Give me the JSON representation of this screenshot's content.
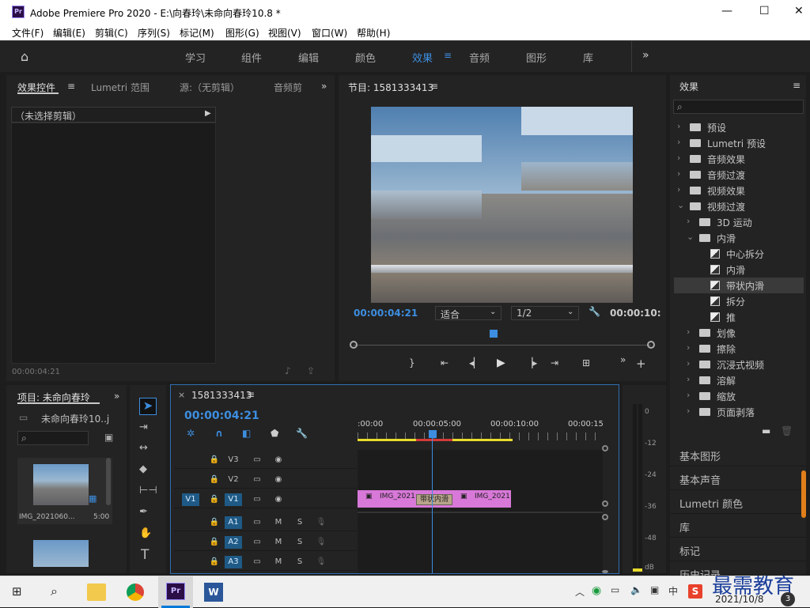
{
  "window": {
    "title": "Adobe Premiere Pro 2020 - E:\\向春玲\\未命向春玲10.8 *",
    "logo": "Pr"
  },
  "menu": [
    "文件(F)",
    "编辑(E)",
    "剪辑(C)",
    "序列(S)",
    "标记(M)",
    "图形(G)",
    "视图(V)",
    "窗口(W)",
    "帮助(H)"
  ],
  "workspaces": [
    "学习",
    "组件",
    "编辑",
    "颜色",
    "效果",
    "音频",
    "图形",
    "库"
  ],
  "left_top": {
    "tabs": [
      "效果控件",
      "Lumetri 范围",
      "源:（无剪辑）",
      "音频剪"
    ],
    "no_clip": "（未选择剪辑）",
    "timecode": "00:00:04:21"
  },
  "program": {
    "title": "节目: 1581333413",
    "timecode": "00:00:04:21",
    "fit": "适合",
    "resolution": "1/2",
    "end_timecode": "00:00:10:"
  },
  "project": {
    "title": "项目: 未命向春玲",
    "file": "未命向春玲10..j",
    "clip_name": "IMG_2021060...",
    "clip_dur": "5:00"
  },
  "sequence": {
    "name": "1581333413",
    "timecode": "00:00:04:21",
    "ruler": [
      ":00:00",
      "00:00:05:00",
      "00:00:10:00",
      "00:00:15"
    ],
    "tracks": [
      {
        "lock": "🔒",
        "src": "",
        "name": "V3",
        "m": "",
        "s": ""
      },
      {
        "lock": "🔒",
        "src": "",
        "name": "V2",
        "m": "",
        "s": ""
      },
      {
        "lock": "🔒",
        "src": "V1",
        "name": "V1",
        "m": "",
        "s": ""
      },
      {
        "lock": "🔒",
        "src": "",
        "name": "A1",
        "m": "M",
        "s": "S"
      },
      {
        "lock": "🔒",
        "src": "",
        "name": "A2",
        "m": "M",
        "s": "S"
      },
      {
        "lock": "🔒",
        "src": "",
        "name": "A3",
        "m": "M",
        "s": "S"
      }
    ],
    "clip1": "IMG_2021",
    "clip2": "IMG_2021",
    "transition": "带状内滑"
  },
  "meter": [
    "0",
    "-12",
    "-24",
    "-36",
    "-48",
    "dB"
  ],
  "effects": {
    "title": "效果",
    "tree": [
      {
        "label": "预设",
        "indent": 0,
        "open": false,
        "kind": "star"
      },
      {
        "label": "Lumetri 预设",
        "indent": 0,
        "open": false,
        "kind": "star"
      },
      {
        "label": "音频效果",
        "indent": 0,
        "open": false,
        "kind": "folder"
      },
      {
        "label": "音频过渡",
        "indent": 0,
        "open": false,
        "kind": "folder"
      },
      {
        "label": "视频效果",
        "indent": 0,
        "open": false,
        "kind": "folder"
      },
      {
        "label": "视频过渡",
        "indent": 0,
        "open": true,
        "kind": "folder"
      },
      {
        "label": "3D 运动",
        "indent": 1,
        "open": false,
        "kind": "folder"
      },
      {
        "label": "内滑",
        "indent": 1,
        "open": true,
        "kind": "folder"
      },
      {
        "label": "中心拆分",
        "indent": 2,
        "open": false,
        "kind": "preset"
      },
      {
        "label": "内滑",
        "indent": 2,
        "open": false,
        "kind": "preset"
      },
      {
        "label": "带状内滑",
        "indent": 2,
        "open": false,
        "kind": "preset",
        "selected": true
      },
      {
        "label": "拆分",
        "indent": 2,
        "open": false,
        "kind": "preset"
      },
      {
        "label": "推",
        "indent": 2,
        "open": false,
        "kind": "preset"
      },
      {
        "label": "划像",
        "indent": 1,
        "open": false,
        "kind": "folder"
      },
      {
        "label": "擦除",
        "indent": 1,
        "open": false,
        "kind": "folder"
      },
      {
        "label": "沉浸式视频",
        "indent": 1,
        "open": false,
        "kind": "folder"
      },
      {
        "label": "溶解",
        "indent": 1,
        "open": false,
        "kind": "folder"
      },
      {
        "label": "缩放",
        "indent": 1,
        "open": false,
        "kind": "folder"
      },
      {
        "label": "页面剥落",
        "indent": 1,
        "open": false,
        "kind": "folder"
      }
    ]
  },
  "right_panels": [
    "基本图形",
    "基本声音",
    "Lumetri 颜色",
    "库",
    "标记",
    "历史记录"
  ],
  "taskbar": {
    "date": "2021/10/8",
    "ime": "中",
    "badge": "3",
    "watermark": "最需教育"
  },
  "colors": {
    "accent": "#3d8ee0",
    "clip": "#d878d8",
    "transition": "#b8a48a",
    "track_on": "#1f5a86"
  }
}
